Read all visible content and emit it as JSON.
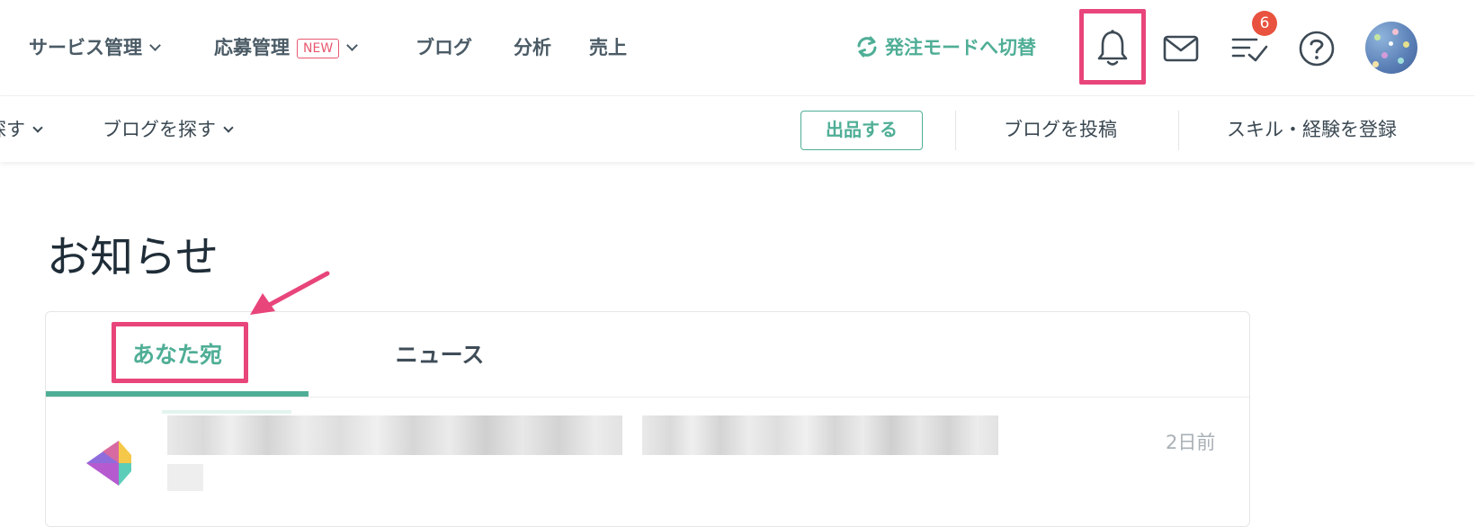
{
  "header": {
    "nav": [
      {
        "label": "サービス管理",
        "has_dropdown": true
      },
      {
        "label": "応募管理",
        "badge": "NEW",
        "has_dropdown": true
      },
      {
        "label": "ブログ"
      },
      {
        "label": "分析"
      },
      {
        "label": "売上"
      }
    ],
    "switch_mode_label": "発注モードへ切替",
    "todo_count": "6",
    "icons": [
      "refresh-icon",
      "bell-icon",
      "mail-icon",
      "todo-checklist-icon",
      "help-icon",
      "avatar"
    ]
  },
  "subnav": {
    "left": [
      {
        "label": "探す",
        "has_dropdown": true
      },
      {
        "label": "ブログを探す",
        "has_dropdown": true
      }
    ],
    "listing_button": "出品する",
    "post_blog": "ブログを投稿",
    "register_skill": "スキル・経験を登録"
  },
  "page": {
    "title": "お知らせ",
    "tabs": [
      {
        "label": "あなた宛",
        "active": true
      },
      {
        "label": "ニュース",
        "active": false
      }
    ],
    "notifications": [
      {
        "time_ago": "2日前"
      }
    ]
  },
  "colors": {
    "accent_green": "#4fae96",
    "highlight_pink": "#e8457a",
    "badge_red": "#e8523e",
    "new_badge": "#e8586f"
  }
}
